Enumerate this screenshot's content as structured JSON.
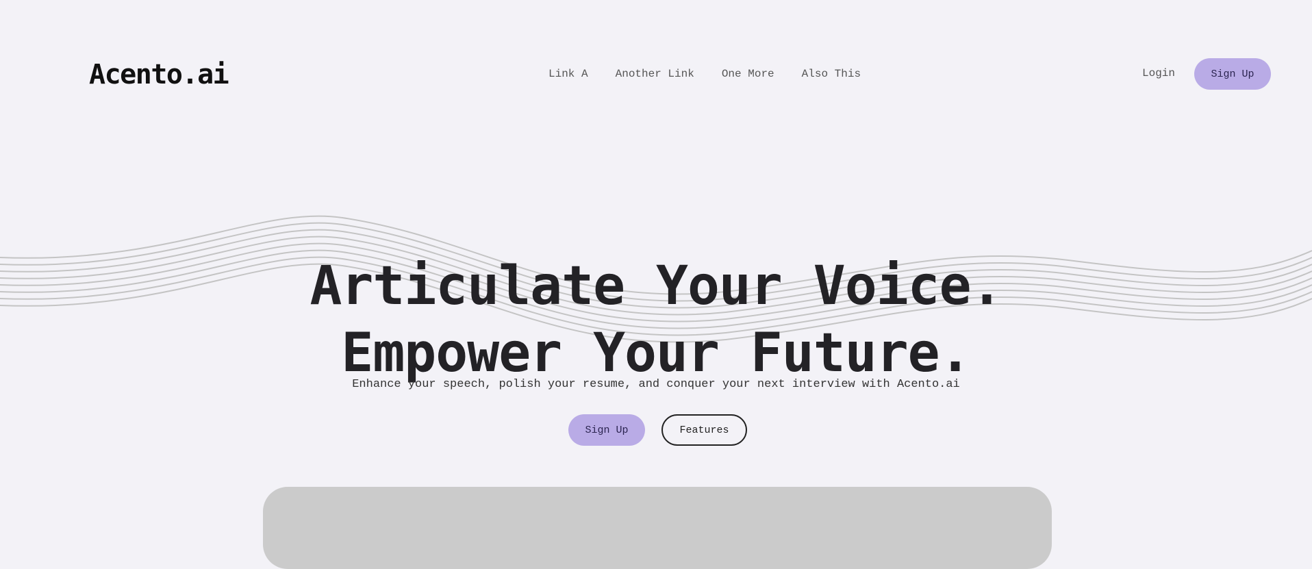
{
  "brand": {
    "name": "Acento.ai"
  },
  "nav": {
    "links": [
      "Link A",
      "Another Link",
      "One More",
      "Also This"
    ],
    "login_label": "Login",
    "signup_label": "Sign Up"
  },
  "hero": {
    "headline_line1": "Articulate Your Voice.",
    "headline_line2": "Empower Your Future.",
    "subtitle": "Enhance your speech, polish your resume, and conquer your next interview with Acento.ai",
    "primary_cta": "Sign Up",
    "secondary_cta": "Features",
    "decoration_icon": "wave-lines-icon"
  },
  "colors": {
    "background": "#f3f2f7",
    "accent": "#b9abe6",
    "text": "#232226",
    "wave_stroke": "#c4c4c4",
    "preview_panel": "#cbcbcb"
  }
}
